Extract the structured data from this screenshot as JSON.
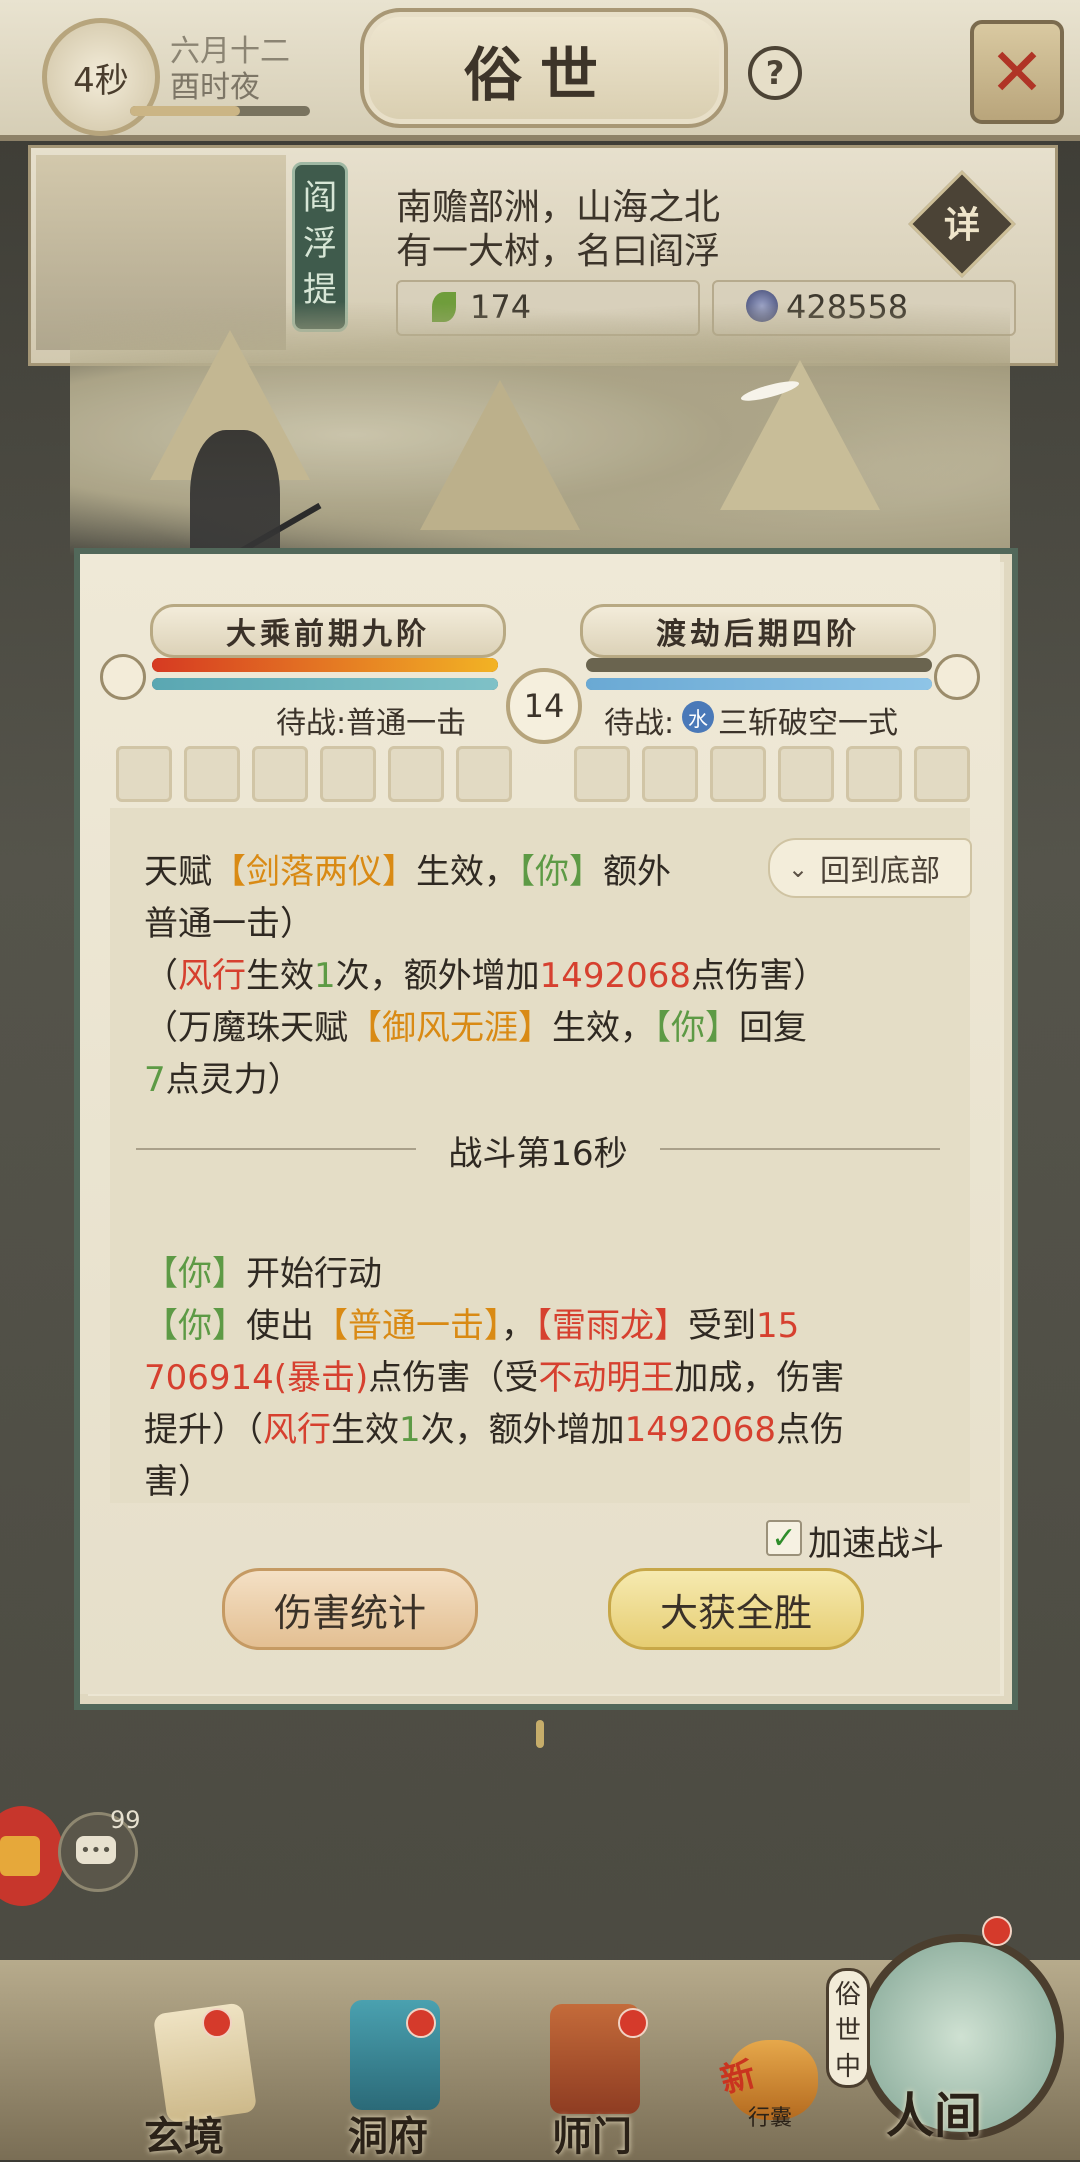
{
  "topbar": {
    "timer": "4秒",
    "date": "六月十二",
    "time_of_day": "酉时夜",
    "title": "俗世",
    "help_icon": "help-icon",
    "close_icon": "close-icon"
  },
  "region": {
    "tag": "阎浮提",
    "desc_line1": "南赡部洲，山海之北",
    "desc_line2": "有一大树，名曰阎浮",
    "detail_label": "详",
    "resources": {
      "herb": "174",
      "spirit_stone": "428558"
    }
  },
  "battle": {
    "player": {
      "realm": "大乘前期九阶",
      "waiting": "待战:普通一击",
      "hp_fraction": 1.0,
      "mp_fraction": 1.0
    },
    "enemy": {
      "realm": "渡劫后期四阶",
      "waiting_prefix": "待战:",
      "element": "水",
      "waiting_skill": "三斩破空一式",
      "hp_fraction": 0.0,
      "mp_fraction": 1.0
    },
    "round": "14",
    "scroll_to_bottom": "回到底部",
    "log": {
      "l1": {
        "a": "天赋",
        "b": "【剑落两仪】",
        "c": "生效，",
        "d": "【你】",
        "e": "额外"
      },
      "l2": "普通一击）",
      "l3": {
        "a": "（",
        "b": "风行",
        "c": "生效",
        "d": "1",
        "e": "次，额外增加",
        "f": "1492068",
        "g": "点伤害）"
      },
      "l4": {
        "a": "（万魔珠天赋",
        "b": "【御风无涯】",
        "c": "生效，",
        "d": "【你】",
        "e": "回复"
      },
      "l5": {
        "a": "7",
        "b": "点灵力）"
      },
      "separator": "战斗第16秒",
      "l6": {
        "a": "【你】",
        "b": "开始行动"
      },
      "l7": {
        "a": "【你】",
        "b": "使出",
        "c": "【普通一击】",
        "d": "，",
        "e": "【雷雨龙】",
        "f": "受到",
        "g": "15"
      },
      "l8": {
        "a": "706914(暴击)",
        "b": "点伤害（受",
        "c": "不动明王",
        "d": "加成，伤害"
      },
      "l9": {
        "a": "提升）（",
        "b": "风行",
        "c": "生效",
        "d": "1",
        "e": "次，额外增加",
        "f": "1492068",
        "g": "点伤"
      },
      "l10": "害）"
    },
    "speed_up_label": "加速战斗",
    "speed_up_checked": true,
    "damage_stats_button": "伤害统计",
    "victory_button": "大获全胜"
  },
  "side": {
    "chat_count": "99"
  },
  "nav": {
    "items": [
      {
        "label": "玄境",
        "icon": "scroll-icon"
      },
      {
        "label": "洞府",
        "icon": "pavilion-icon"
      },
      {
        "label": "师门",
        "icon": "banner-icon"
      },
      {
        "label": "行囊",
        "icon": "bag-icon",
        "badge": "新"
      }
    ],
    "world": {
      "label": "人间",
      "state": "俗世中"
    }
  },
  "colors": {
    "accent_orange": "#d98a14",
    "accent_green": "#5d9a45",
    "accent_red": "#d6402f",
    "scroll_border": "#52685a"
  }
}
